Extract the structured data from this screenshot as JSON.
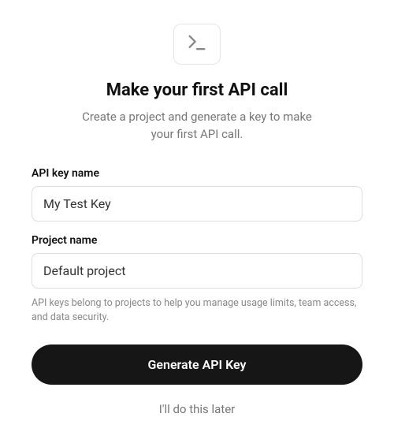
{
  "header": {
    "icon": "terminal-icon",
    "title": "Make your first API call",
    "subtitle": "Create a project and generate a key to make your first API call."
  },
  "form": {
    "api_key_name": {
      "label": "API key name",
      "value": "My Test Key"
    },
    "project_name": {
      "label": "Project name",
      "value": "Default project"
    },
    "helper_text": "API keys belong to projects to help you manage usage limits, team access, and data security."
  },
  "actions": {
    "primary_label": "Generate API Key",
    "secondary_label": "I'll do this later"
  }
}
